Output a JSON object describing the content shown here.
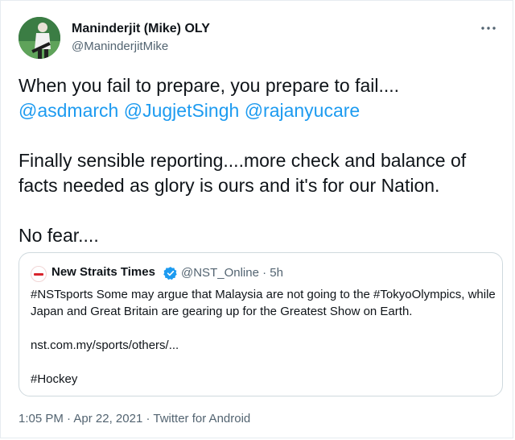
{
  "author": {
    "name": "Maninderjit (Mike) OLY",
    "handle": "@ManinderjitMike"
  },
  "more_icon": "more-horizontal-icon",
  "tweet": {
    "line1": "When you fail to prepare, you prepare to fail....",
    "mentions": [
      "@asdmarch",
      "@JugjetSingh",
      "@rajanyucare"
    ],
    "line3": "Finally sensible reporting....more check and balance of facts needed as glory is ours and it's for our Nation.",
    "line4": "No fear...."
  },
  "quote": {
    "name": "New Straits Times",
    "handle": "@NST_Online",
    "separator": "·",
    "age": "5h",
    "text": "#NSTsports Some may argue that Malaysia are not going to the #TokyoOlympics, while Japan and Great Britain are gearing up for the Greatest Show on Earth.",
    "link": "nst.com.my/sports/others/...",
    "hashtag": "#Hockey"
  },
  "footer": {
    "time": "1:05 PM",
    "sep1": "·",
    "date": "Apr 22, 2021",
    "sep2": "·",
    "app": "Twitter for Android"
  },
  "colors": {
    "accent": "#1d9bf0",
    "secondary_text": "#536471",
    "nst_red": "#d8242c"
  }
}
